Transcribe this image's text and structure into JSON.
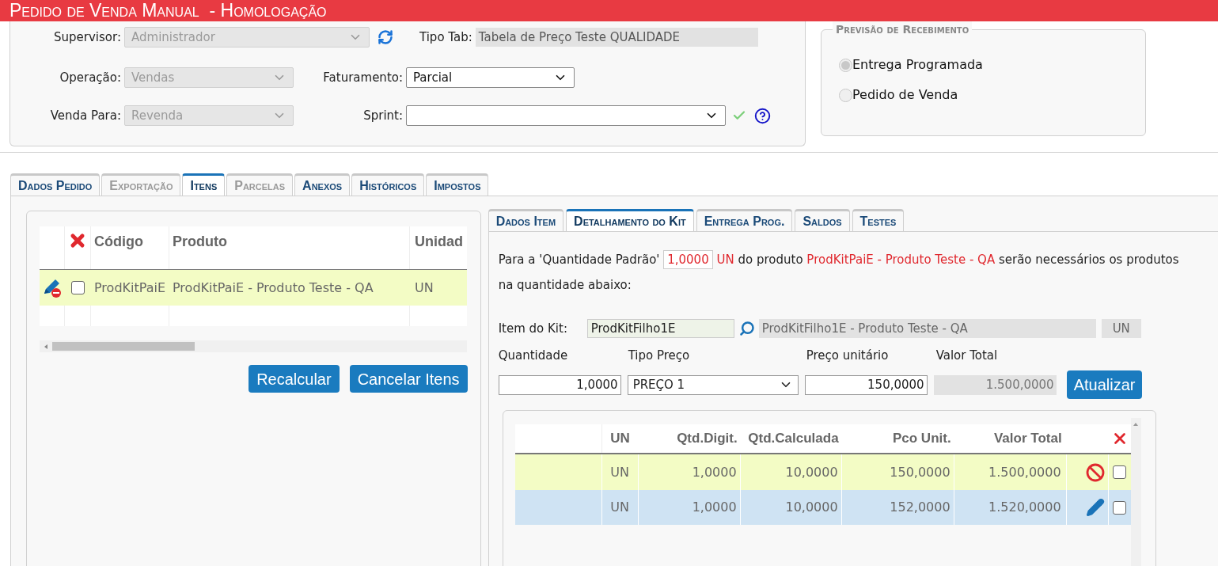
{
  "title": "Pedido de Venda Manual  - Homologação",
  "header_form": {
    "supervisor": {
      "label": "Supervisor:",
      "value": "Administrador",
      "disabled": true
    },
    "tipo_tab": {
      "label": "Tipo Tab:",
      "value": "Tabela de Preço Teste QUALIDADE"
    },
    "operacao": {
      "label": "Operação:",
      "value": "Vendas",
      "disabled": true
    },
    "faturamento": {
      "label": "Faturamento:",
      "value": "Parcial",
      "disabled": false
    },
    "venda_para": {
      "label": "Venda Para:",
      "value": "Revenda",
      "disabled": true
    },
    "sprint": {
      "label": "Sprint:",
      "disabled": false
    }
  },
  "previsao": {
    "legend": "Previsão de Recebimento",
    "options": [
      {
        "label": "Entrega Programada",
        "selected": true
      },
      {
        "label": "Pedido de Venda",
        "selected": false
      }
    ]
  },
  "tabs": [
    {
      "label": "Dados Pedido",
      "selected": false,
      "disabled": false
    },
    {
      "label": "Exportação",
      "selected": false,
      "disabled": true
    },
    {
      "label": "Itens",
      "selected": true,
      "disabled": false
    },
    {
      "label": "Parcelas",
      "selected": false,
      "disabled": true
    },
    {
      "label": "Anexos",
      "selected": false,
      "disabled": false
    },
    {
      "label": "Históricos",
      "selected": false,
      "disabled": false
    },
    {
      "label": "Impostos",
      "selected": false,
      "disabled": false
    }
  ],
  "items_grid": {
    "columns": [
      "Código",
      "Produto",
      "Unidad"
    ],
    "rows": [
      {
        "code": "ProdKitPaiE",
        "product": "ProdKitPaiE - Produto Teste - QA",
        "unit": "UN",
        "checked": false
      }
    ]
  },
  "item_buttons": [
    "Recalcular",
    "Cancelar Itens"
  ],
  "item_tabs": [
    {
      "label": "Dados Item",
      "selected": false
    },
    {
      "label": "Detalhamento do Kit",
      "selected": true
    },
    {
      "label": "Entrega Prog.",
      "selected": false
    },
    {
      "label": "Saldos",
      "selected": false
    },
    {
      "label": "Testes",
      "selected": false
    }
  ],
  "kit": {
    "intro": {
      "prefix": "Para a 'Quantidade Padrão'",
      "quantity": "1,0000",
      "unit": "UN",
      "middle": "do produto",
      "product": "ProdKitPaiE - Produto Teste - QA",
      "suffix": "serão necessários os produtos na quantidade abaixo:"
    },
    "item_label": "Item do Kit:",
    "item_code": "ProdKitFilho1E",
    "item_description": "ProdKitFilho1E - Produto Teste - QA",
    "item_unit": "UN",
    "quantity": {
      "label": "Quantidade",
      "value": "1,0000"
    },
    "price_type": {
      "label": "Tipo Preço",
      "value": "PREÇO 1"
    },
    "unit_price": {
      "label": "Preço unitário",
      "value": "150,0000"
    },
    "total": {
      "label": "Valor Total",
      "value": "1.500,0000"
    },
    "update_button": "Atualizar"
  },
  "kit_grid": {
    "columns": [
      "UN",
      "Qtd.Digit.",
      "Qtd.Calculada",
      "Pco Unit.",
      "Valor Total"
    ],
    "rows": [
      {
        "kind": "blocked",
        "un": "UN",
        "qtd_digit": "1,0000",
        "qtd_calculada": "10,0000",
        "pco_unit": "150,0000",
        "valor_total": "1.500,0000",
        "checked": false
      },
      {
        "kind": "editable",
        "un": "UN",
        "qtd_digit": "1,0000",
        "qtd_calculada": "10,0000",
        "pco_unit": "152,0000",
        "valor_total": "1.520,0000",
        "checked": false
      }
    ]
  }
}
